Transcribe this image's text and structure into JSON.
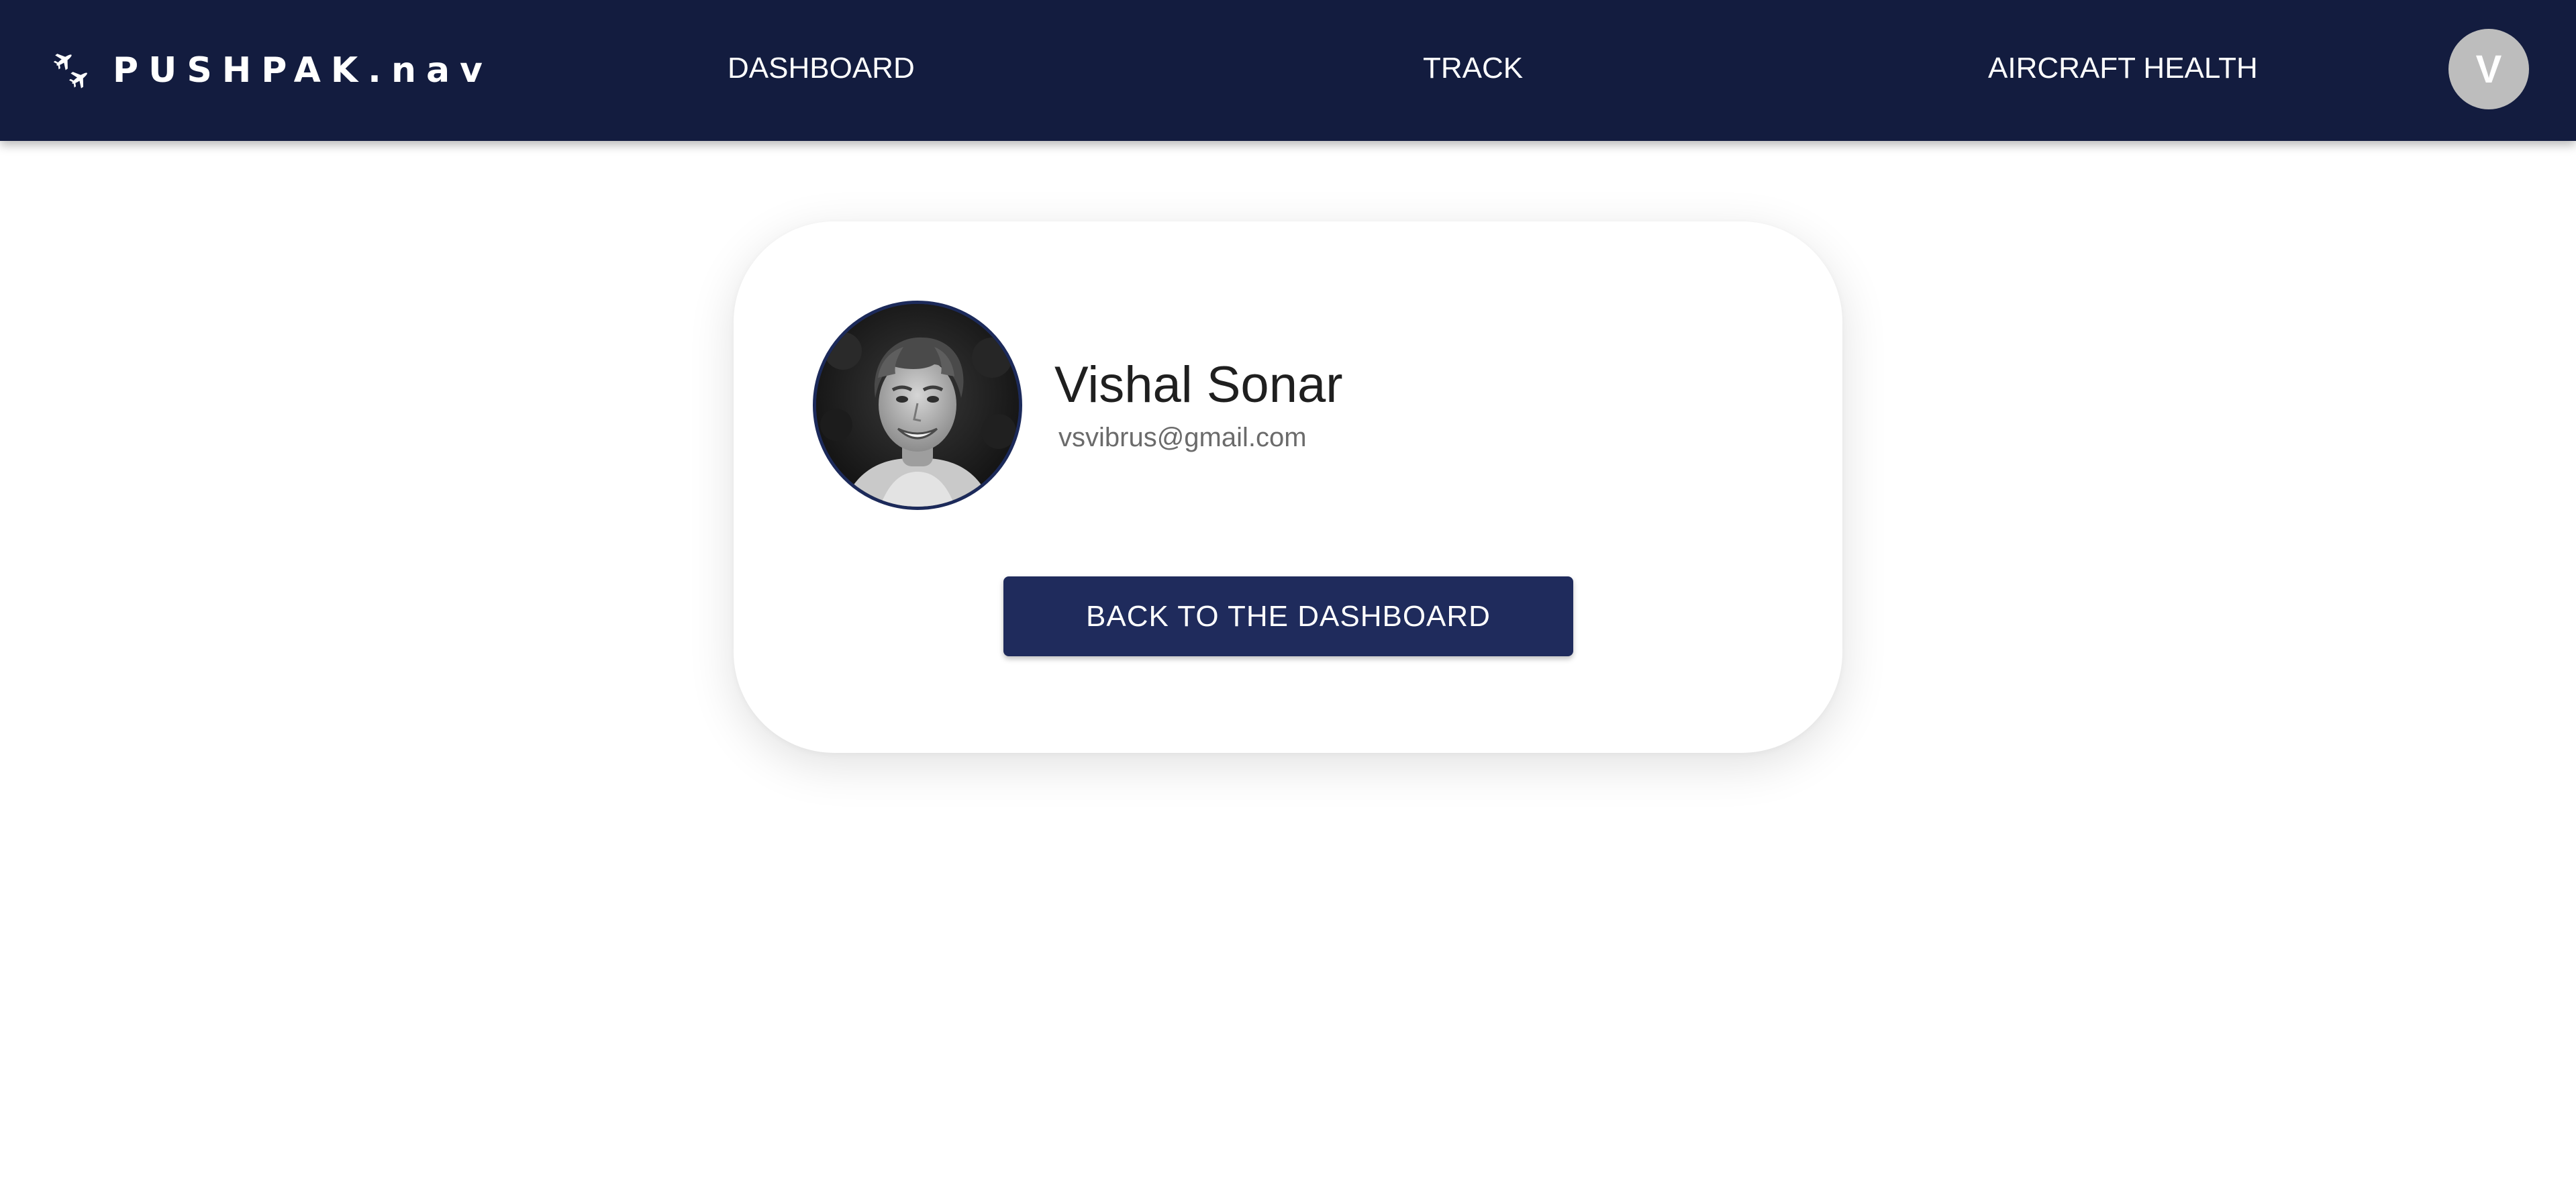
{
  "navbar": {
    "brand": {
      "icon": "airplanes-icon",
      "text": "PUSHPAK.nav"
    },
    "links": [
      {
        "label": "DASHBOARD"
      },
      {
        "label": "TRACK"
      },
      {
        "label": "AIRCRAFT HEALTH"
      }
    ],
    "avatar_initial": "V",
    "background_color": "#131c3f"
  },
  "profile": {
    "name": "Vishal Sonar",
    "email": "vsvibrus@gmail.com",
    "photo": "profile-photo"
  },
  "actions": {
    "back_label": "BACK TO THE DASHBOARD",
    "button_color": "#1f2b5c"
  }
}
